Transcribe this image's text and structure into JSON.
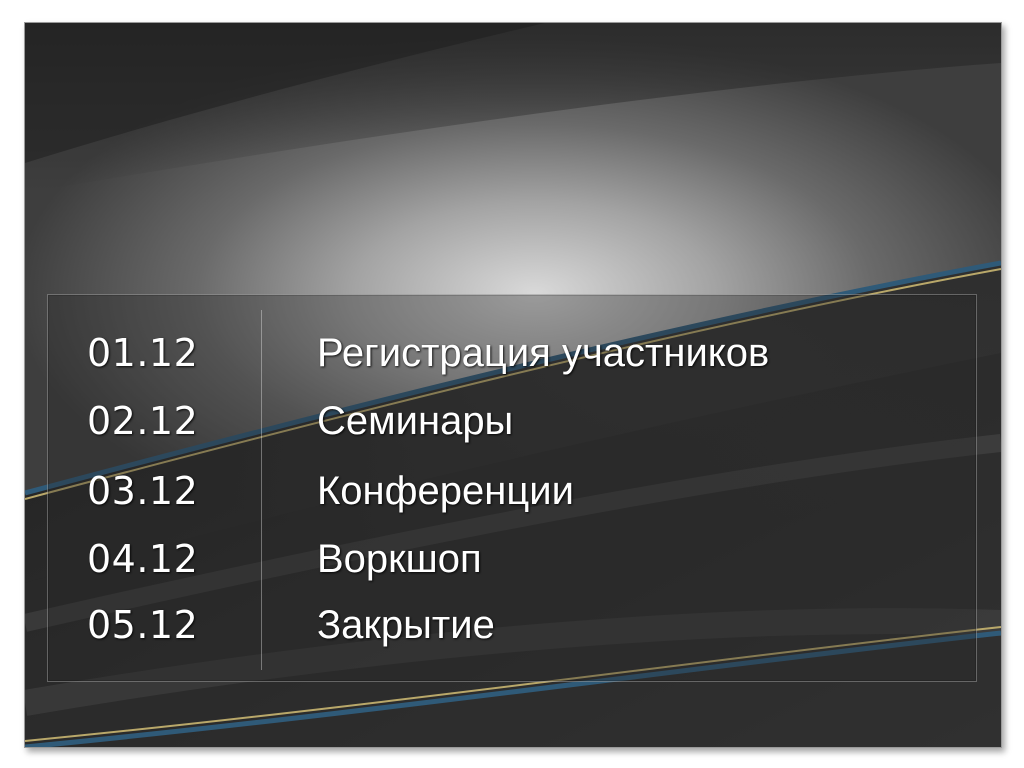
{
  "schedule": [
    {
      "date": "01.12",
      "event": "Регистрация участников"
    },
    {
      "date": "02.12",
      "event": "Семинары"
    },
    {
      "date": "03.12",
      "event": "Конференции"
    },
    {
      "date": "04.12",
      "event": "Воркшоп"
    },
    {
      "date": "05.12",
      "event": "Закрытие"
    }
  ],
  "colors": {
    "accent_blue": "#2f5a78",
    "accent_gold": "#b9a86a",
    "text": "#ffffff"
  }
}
